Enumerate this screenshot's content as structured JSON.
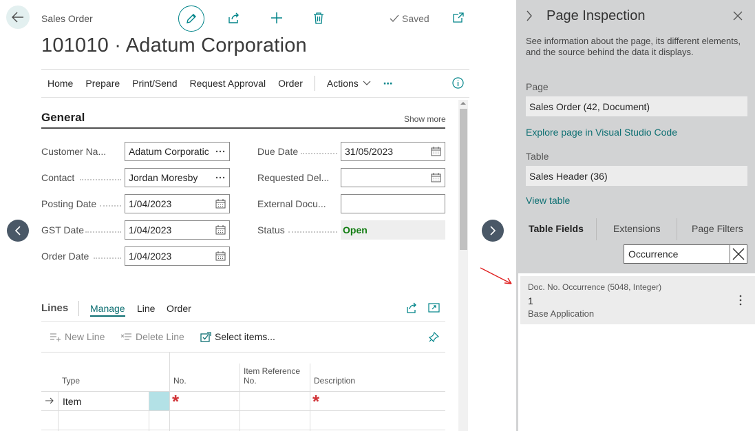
{
  "header": {
    "page_caption": "Sales Order",
    "title": "101010 · Adatum Corporation",
    "saved_label": "Saved"
  },
  "actions": [
    "Home",
    "Prepare",
    "Print/Send",
    "Request Approval",
    "Order",
    "Actions"
  ],
  "general": {
    "title": "General",
    "show_more": "Show more",
    "customer_name_label": "Customer Na...",
    "customer_name_value": "Adatum Corporatic",
    "contact_label": "Contact",
    "contact_value": "Jordan Moresby",
    "posting_date_label": "Posting Date",
    "posting_date_value": "1/04/2023",
    "gst_date_label": "GST Date",
    "gst_date_value": "1/04/2023",
    "order_date_label": "Order Date",
    "order_date_value": "1/04/2023",
    "due_date_label": "Due Date",
    "due_date_value": "31/05/2023",
    "requested_del_label": "Requested Del...",
    "requested_del_value": "",
    "external_doc_label": "External Docu...",
    "external_doc_value": "",
    "status_label": "Status",
    "status_value": "Open"
  },
  "lines": {
    "title": "Lines",
    "tabs": [
      "Manage",
      "Line",
      "Order"
    ],
    "new_line": "New Line",
    "delete_line": "Delete Line",
    "select_items": "Select items...",
    "col_type": "Type",
    "col_no": "No.",
    "col_item_ref_1": "Item Reference",
    "col_item_ref_2": "No.",
    "col_description": "Description",
    "row1_type": "Item",
    "required_mark": "*"
  },
  "panel": {
    "title": "Page Inspection",
    "description": "See information about the page, its different elements, and the source behind the data it displays.",
    "page_label": "Page",
    "page_value": "Sales Order (42, Document)",
    "explore_link": "Explore page in Visual Studio Code",
    "table_label": "Table",
    "table_value": "Sales Header (36)",
    "view_table_link": "View table",
    "tabs": [
      "Table Fields",
      "Extensions",
      "Page Filters"
    ],
    "search_value": "Occurrence",
    "result": {
      "field": "Doc. No. Occurrence (5048, Integer)",
      "value": "1",
      "source": "Base Application"
    }
  },
  "colors": {
    "accent": "#008489",
    "link": "#0d6f72",
    "status_open": "#107c10",
    "required": "#d13438",
    "arrow": "#e02020"
  }
}
